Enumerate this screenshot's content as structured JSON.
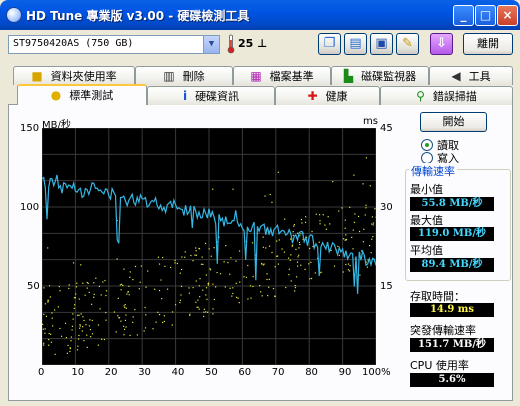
{
  "window": {
    "title": "HD Tune 專業版 v3.00 - 硬碟檢測工具",
    "minimize": "_",
    "maximize": "□",
    "close": "×"
  },
  "toolbar": {
    "drive_value": "ST9750420AS (750 GB)",
    "temperature": "25 ⊥",
    "exit_label": "離開"
  },
  "tabs_top": [
    {
      "label": "資料夾使用率"
    },
    {
      "label": "刪除"
    },
    {
      "label": "檔案基準"
    },
    {
      "label": "磁碟監視器"
    },
    {
      "label": "工具"
    }
  ],
  "tabs_bottom": [
    {
      "label": "標準測試"
    },
    {
      "label": "硬碟資訊"
    },
    {
      "label": "健康"
    },
    {
      "label": "錯誤掃描"
    }
  ],
  "chart_data": {
    "type": "line",
    "ylabel_left": "MB/秒",
    "ylabel_right": "ms",
    "y_ticks_left": [
      "150",
      "100",
      "50"
    ],
    "y_ticks_right": [
      "45",
      "30",
      "15"
    ],
    "x_ticks": [
      "0",
      "10",
      "20",
      "30",
      "40",
      "50",
      "60",
      "70",
      "80",
      "90",
      "100%"
    ],
    "ylim_left": [
      0,
      150
    ],
    "ylim_right": [
      0,
      45
    ],
    "x": [
      0,
      2,
      4,
      6,
      8,
      10,
      12,
      14,
      16,
      18,
      20,
      22,
      24,
      26,
      28,
      30,
      32,
      34,
      36,
      38,
      40,
      42,
      44,
      46,
      48,
      50,
      52,
      54,
      56,
      58,
      60,
      62,
      64,
      66,
      68,
      70,
      72,
      74,
      76,
      78,
      80,
      82,
      84,
      86,
      88,
      90,
      92,
      94,
      96,
      98,
      100
    ],
    "series": [
      {
        "values": [
          116,
          114,
          118,
          112,
          113,
          114,
          110,
          111,
          113,
          108,
          110,
          106,
          107,
          104,
          105,
          108,
          102,
          104,
          101,
          100,
          104,
          98,
          99,
          96,
          97,
          95,
          93,
          92,
          91,
          94,
          89,
          88,
          87,
          86,
          84,
          85,
          84,
          82,
          80,
          81,
          79,
          77,
          78,
          75,
          74,
          72,
          70,
          70,
          68,
          66,
          63
        ]
      }
    ],
    "color_transfer": "#35b7e3",
    "color_access": "#e8e840",
    "grid": true
  },
  "controls": {
    "start_label": "開始",
    "read_label": "讀取",
    "write_label": "寫入",
    "read_selected": true
  },
  "stats": {
    "group_title": "傳輸速率",
    "min_label": "最小值",
    "min_value": "55.8 MB/秒",
    "max_label": "最大值",
    "max_value": "119.0 MB/秒",
    "avg_label": "平均值",
    "avg_value": "89.4 MB/秒",
    "access_label": "存取時間：",
    "access_value": "14.9 ms",
    "burst_label": "突發傳輸速率",
    "burst_value": "151.7 MB/秒",
    "cpu_label": "CPU 使用率",
    "cpu_value": "5.6%"
  },
  "colors": {
    "titlebar": "#0054e3",
    "chart_bg": "#000000",
    "group_title": "#0046d5"
  }
}
